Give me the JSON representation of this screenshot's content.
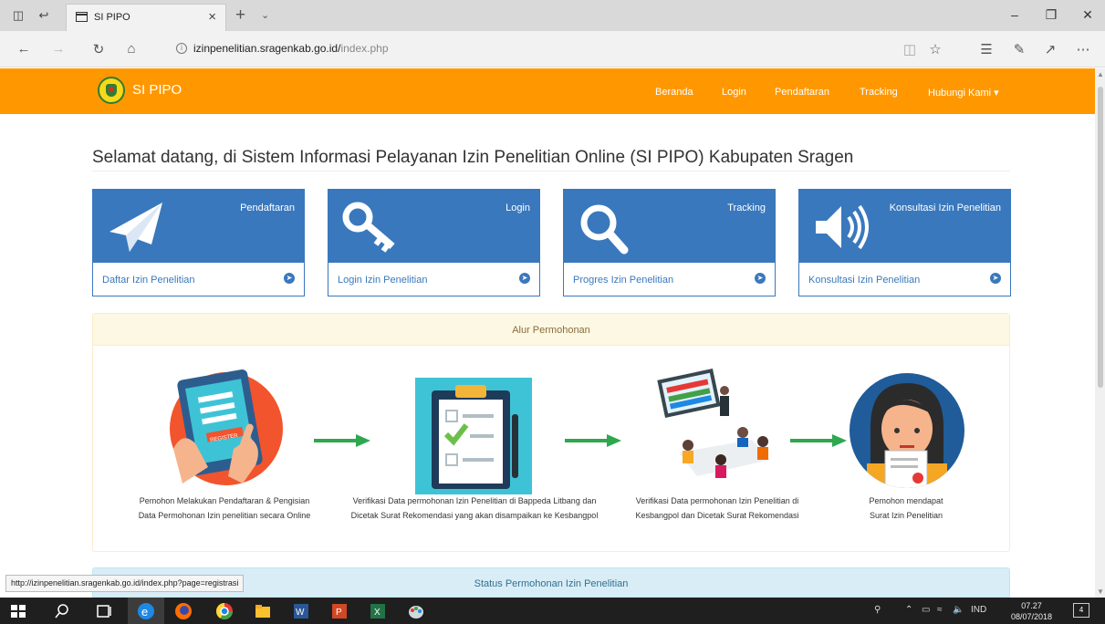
{
  "browser": {
    "tab_title": "SI PIPO",
    "address_host": "izinpenelitian.sragenkab.go.id/",
    "address_path": "index.php",
    "status_url": "http://izinpenelitian.sragenkab.go.id/index.php?page=registrasi"
  },
  "site": {
    "brand": "SI PIPO",
    "menu": [
      "Beranda",
      "Login",
      "Pendaftaran",
      "Tracking",
      "Hubungi Kami ▾"
    ]
  },
  "welcome": "Selamat datang, di Sistem Informasi Pelayanan Izin Penelitian Online (SI PIPO) Kabupaten Sragen",
  "cards": [
    {
      "title": "Pendaftaran",
      "footer": "Daftar Izin Penelitian",
      "icon": "paper-plane-icon"
    },
    {
      "title": "Login",
      "footer": "Login Izin Penelitian",
      "icon": "key-icon"
    },
    {
      "title": "Tracking",
      "footer": "Progres Izin Penelitian",
      "icon": "search-icon"
    },
    {
      "title": "Konsultasi Izin Penelitian",
      "footer": "Konsultasi Izin Penelitian",
      "icon": "volume-icon"
    }
  ],
  "alur": {
    "title": "Alur Permohonan",
    "register_label": "REGISTER",
    "steps": [
      {
        "line1": "Pemohon Melakukan Pendaftaran & Pengisian",
        "line2": "Data Permohonan Izin penelitian secara Online"
      },
      {
        "line1": "Verifikasi Data permohonan Izin Penelitian di Bappeda Litbang dan",
        "line2": "Dicetak Surat Rekomendasi yang akan disampaikan ke Kesbangpol"
      },
      {
        "line1": "Verifikasi Data permohonan Izin Penelitian di",
        "line2": "Kesbangpol dan Dicetak Surat Rekomendasi"
      },
      {
        "line1": "Pemohon mendapat",
        "line2": "Surat Izin Penelitian"
      }
    ]
  },
  "status_panel": {
    "title": "Status Permohonan Izin Penelitian"
  },
  "taskbar": {
    "lang": "IND",
    "time": "07.27",
    "date": "08/07/2018",
    "notifications": "4"
  },
  "colors": {
    "orange": "#ff9800",
    "blue": "#3a78bd",
    "green": "#2ea84f"
  }
}
